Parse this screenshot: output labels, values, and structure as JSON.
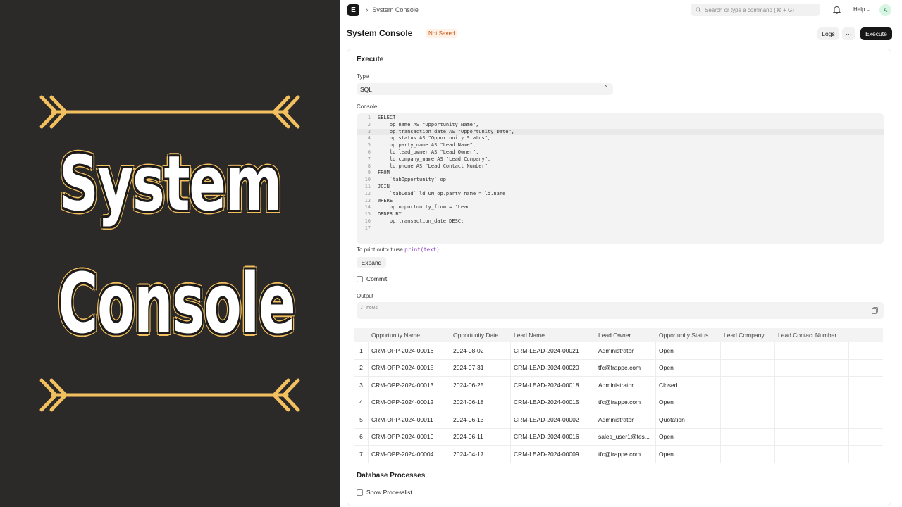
{
  "banner": {
    "line1": "System",
    "line2": "Console"
  },
  "navbar": {
    "logo_letter": "E",
    "breadcrumb": "System Console",
    "search_placeholder": "Search or type a command (⌘ + G)",
    "help_label": "Help",
    "avatar_letter": "A"
  },
  "page": {
    "title": "System Console",
    "status_badge": "Not Saved",
    "logs_label": "Logs",
    "more_label": "···",
    "execute_label": "Execute"
  },
  "execute": {
    "section_title": "Execute",
    "type_label": "Type",
    "type_value": "SQL",
    "console_label": "Console",
    "code_lines": [
      "SELECT",
      "    op.name AS \"Opportunity Name\",",
      "    op.transaction_date AS \"Opportunity Date\",",
      "    op.status AS \"Opportunity Status\",",
      "    op.party_name AS \"Lead Name\",",
      "    ld.lead_owner AS \"Lead Owner\",",
      "    ld.company_name AS \"Lead Company\",",
      "    ld.phone AS \"Lead Contact Number\"",
      "FROM",
      "    `tabOpportunity` op",
      "JOIN",
      "    `tabLead` ld ON op.party_name = ld.name",
      "WHERE",
      "    op.opportunity_from = 'Lead'",
      "ORDER BY",
      "    op.transaction_date DESC;",
      ""
    ],
    "hint_text": "To print output use",
    "hint_code": "print(text)",
    "expand_label": "Expand",
    "commit_label": "Commit",
    "output_label": "Output",
    "output_text": "7 rows"
  },
  "results": {
    "columns": [
      "Opportunity Name",
      "Opportunity Date",
      "Lead Name",
      "Lead Owner",
      "Opportunity Status",
      "Lead Company",
      "Lead Contact Number"
    ],
    "rows": [
      [
        "1",
        "CRM-OPP-2024-00016",
        "2024-08-02",
        "CRM-LEAD-2024-00021",
        "Administrator",
        "Open",
        "",
        ""
      ],
      [
        "2",
        "CRM-OPP-2024-00015",
        "2024-07-31",
        "CRM-LEAD-2024-00020",
        "tfc@frappe.com",
        "Open",
        "",
        ""
      ],
      [
        "3",
        "CRM-OPP-2024-00013",
        "2024-06-25",
        "CRM-LEAD-2024-00018",
        "Administrator",
        "Closed",
        "",
        ""
      ],
      [
        "4",
        "CRM-OPP-2024-00012",
        "2024-06-18",
        "CRM-LEAD-2024-00015",
        "tfc@frappe.com",
        "Open",
        "",
        ""
      ],
      [
        "5",
        "CRM-OPP-2024-00011",
        "2024-06-13",
        "CRM-LEAD-2024-00002",
        "Administrator",
        "Quotation",
        "",
        ""
      ],
      [
        "6",
        "CRM-OPP-2024-00010",
        "2024-06-11",
        "CRM-LEAD-2024-00016",
        "sales_user1@tes...",
        "Open",
        "",
        ""
      ],
      [
        "7",
        "CRM-OPP-2024-00004",
        "2024-04-17",
        "CRM-LEAD-2024-00009",
        "tfc@frappe.com",
        "Open",
        "",
        ""
      ]
    ]
  },
  "db": {
    "section_title": "Database Processes",
    "show_processlist_label": "Show Processlist"
  }
}
